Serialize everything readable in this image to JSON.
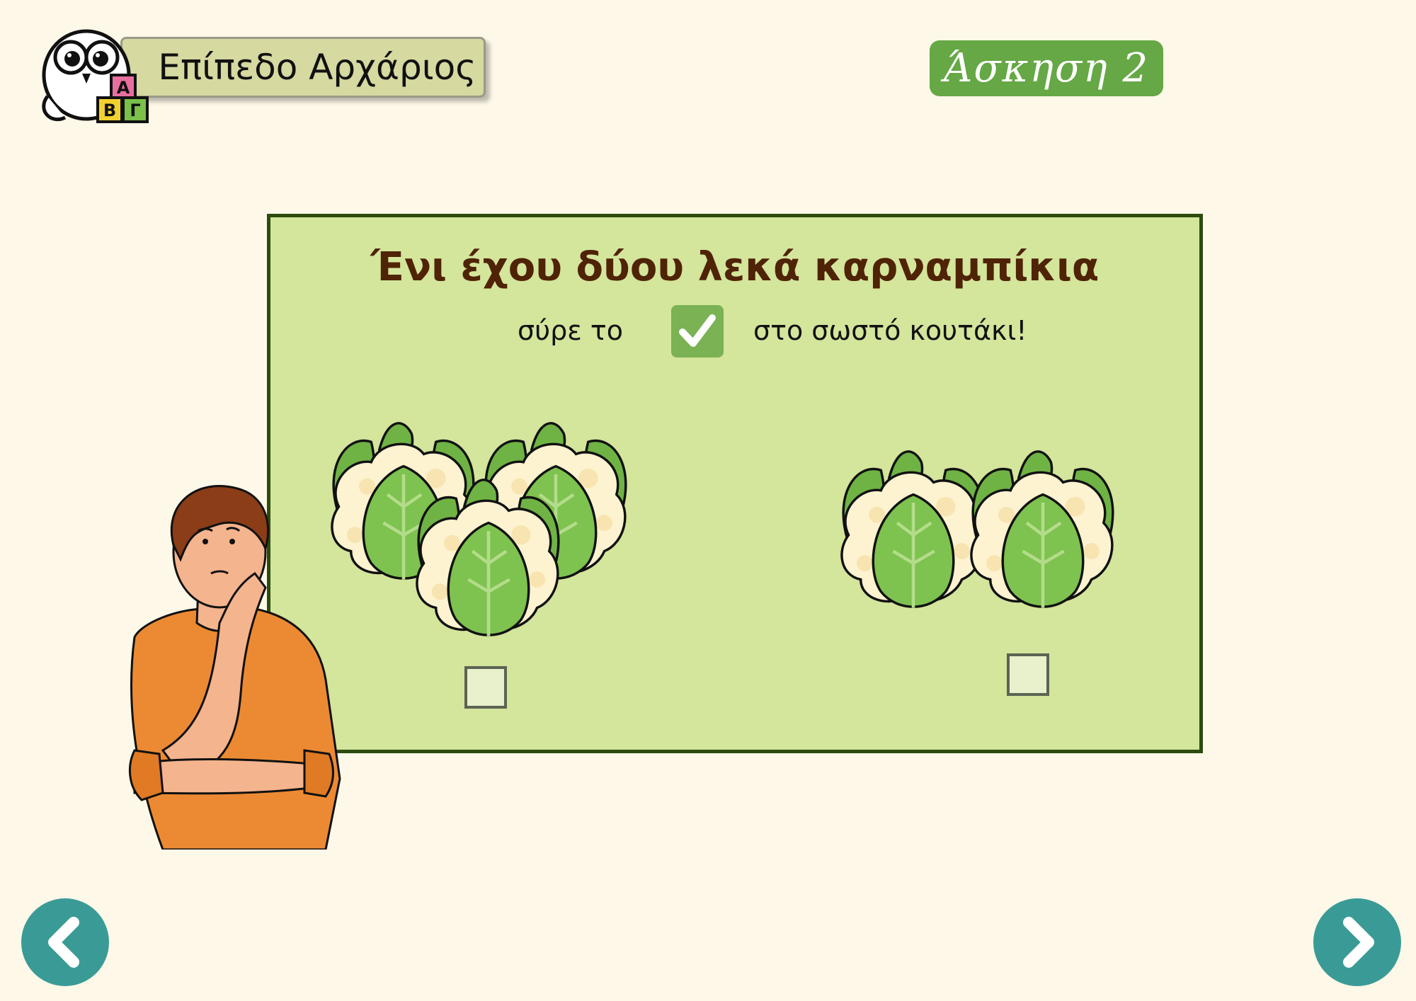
{
  "header": {
    "level_label": "Επίπεδο Αρχάριος",
    "logo_letters": [
      "Α",
      "Β",
      "Γ"
    ],
    "exercise_label": "Άσκηση 2"
  },
  "exercise": {
    "question": "Ένι έχου δύου λεκά καρναμπίκια",
    "instruction_before": "σύρε το",
    "instruction_after": "στο σωστό κουτάκι!",
    "options": [
      {
        "count": 3,
        "item": "cauliflower"
      },
      {
        "count": 2,
        "item": "cauliflower"
      }
    ]
  },
  "icons": {
    "check": "checkmark-icon",
    "prev": "chevron-left-icon",
    "next": "chevron-right-icon"
  },
  "colors": {
    "background": "#fdf8e8",
    "panel": "#d4e59c",
    "panel_border": "#2c4c0e",
    "title": "#4f2306",
    "badge_green": "#65a845",
    "nav_teal": "#3a9b96"
  }
}
